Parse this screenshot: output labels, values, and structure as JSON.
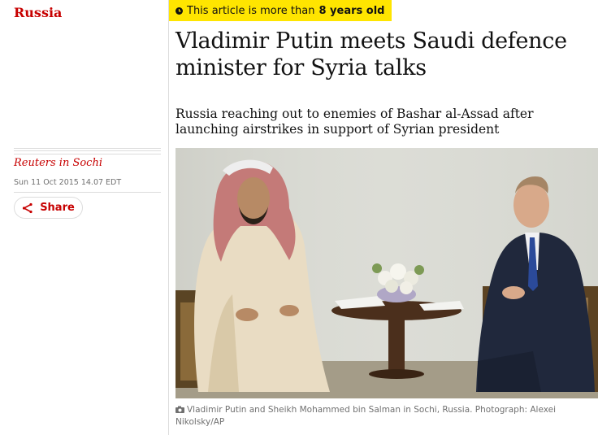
{
  "section": {
    "label": "Russia"
  },
  "meta": {
    "byline": "Reuters in Sochi",
    "dateline": "Sun 11 Oct 2015 14.07 EDT"
  },
  "share": {
    "label": "Share",
    "icon": "share-icon"
  },
  "age_banner": {
    "prefix": "This article is more than",
    "age": "8 years old",
    "icon": "clock-icon"
  },
  "article": {
    "headline": "Vladimir Putin meets Saudi defence minister for Syria talks",
    "standfirst": "Russia reaching out to enemies of Bashar al-Assad after launching airstrikes in support of Syrian president"
  },
  "main_image": {
    "caption": "Vladimir Putin and Sheikh Mohammed bin Salman in Sochi, Russia. Photograph: Alexei Nikolsky/AP",
    "caption_icon": "camera-icon"
  },
  "colors": {
    "accent": "#c70000",
    "banner": "#ffe500",
    "text": "#121212",
    "muted": "#707070",
    "rule": "#dcdcdc"
  }
}
